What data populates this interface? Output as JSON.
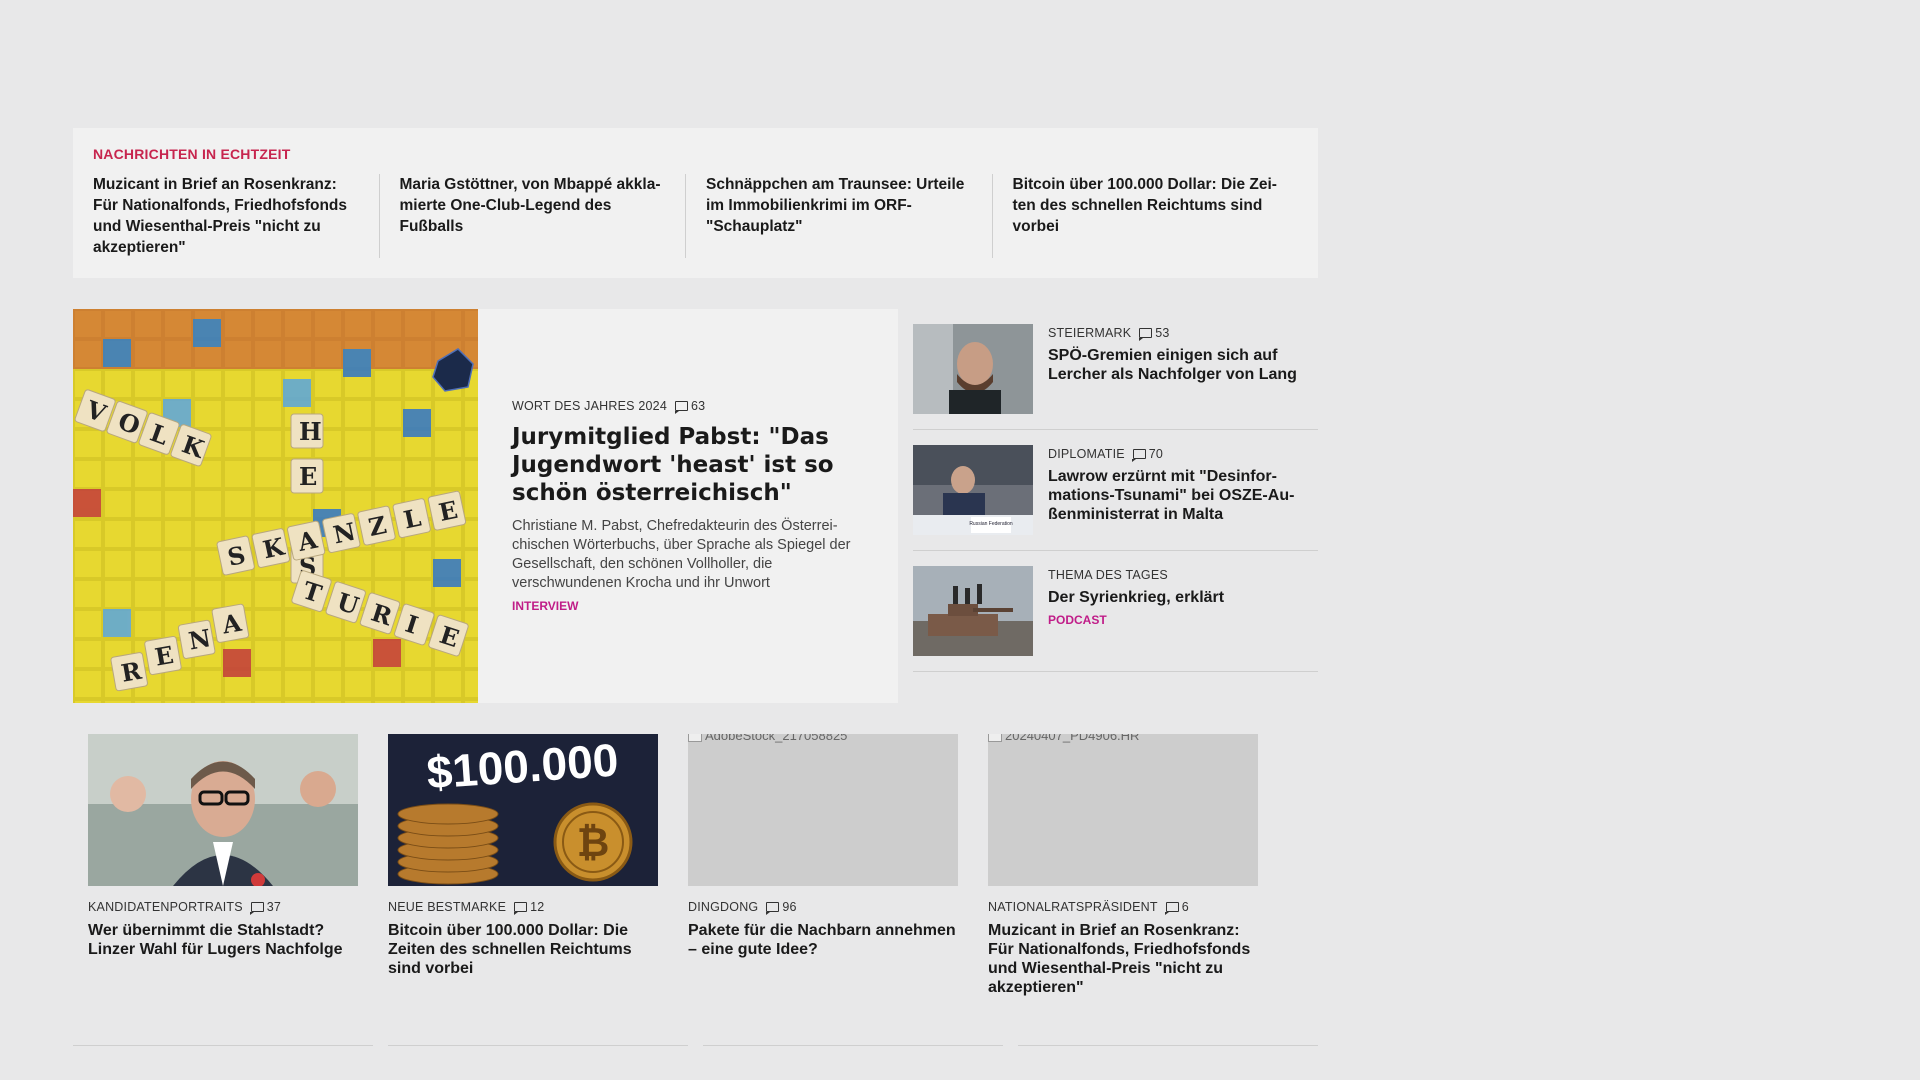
{
  "ticker": {
    "title": "NACHRICHTEN IN ECHTZEIT",
    "items": [
      "Muzicant in Brief an Rosenkranz: Für Nationalfonds, Friedhofsfonds und Wiesenthal-Preis \"nicht zu akzeptieren\"",
      "Maria Gstöttner, von Mbappé akkla­mierte One-Club-Legend des Fußballs",
      "Schnäppchen am Traunsee: Urteile im Immobilienkrimi im ORF-\"Schauplatz\"",
      "Bitcoin über 100.000 Dollar: Die Zei­ten des schnellen Reichtums sind vorbei"
    ]
  },
  "hero": {
    "kicker": "WORT DES JAHRES 2024",
    "comments": "63",
    "title": "Jurymitglied Pabst: \"Das Jugendwort 'heast' ist so schön österreichisch\"",
    "teaser": "Christiane M. Pabst, Chefredakteurin des Österrei­chischen Wörterbuchs, über Sprache als Spiegel der Gesellschaft, den schönen Vollholler, die verschwundenen Krocha und ihr Unwort",
    "tag": "INTERVIEW",
    "scrabble_words": [
      "HEAST",
      "VOLKSKANZLER",
      "RENATURIERUNG"
    ]
  },
  "side": [
    {
      "kicker": "STEIERMARK",
      "comments": "53",
      "title": "SPÖ-Gremien einigen sich auf Lercher als Nachfolger von Lang",
      "tag": ""
    },
    {
      "kicker": "DIPLOMATIE",
      "comments": "70",
      "title": "Lawrow erzürnt mit \"Desinfor­mations-Tsunami\" bei OSZE-Au­ßenministerrat in Malta",
      "tag": "",
      "photo_label": "Russian Federation"
    },
    {
      "kicker": "THEMA DES TAGES",
      "comments": "",
      "title": "Der Syrienkrieg, erklärt",
      "tag": "PODCAST"
    }
  ],
  "cards": [
    {
      "kicker": "KANDIDATENPORTRAITS",
      "comments": "37",
      "title": "Wer übernimmt die Stahlstadt? Linzer Wahl für Lugers Nachfolge",
      "alt": ""
    },
    {
      "kicker": "NEUE BESTMARKE",
      "comments": "12",
      "title": "Bitcoin über 100.000 Dollar: Die Zeiten des schnellen Reichtums sind vorbei",
      "alt": "",
      "img_text": "$100.000",
      "coin_symbol": "₿"
    },
    {
      "kicker": "DINGDONG",
      "comments": "96",
      "title": "Pakete für die Nachbarn annehmen – eine gute Idee?",
      "alt": "AdobeStock_217058825"
    },
    {
      "kicker": "NATIONALRATSPRÄSIDENT",
      "comments": "6",
      "title": "Muzicant in Brief an Rosenkranz: Für Nationalfonds, Friedhofsfonds und Wiesenthal-Preis \"nicht zu akzeptieren\"",
      "alt": "20240407_PD4906.HR"
    }
  ],
  "colors": {
    "accent_red": "#c7254e",
    "tag_magenta": "#c01c88",
    "background": "#e8e8e9",
    "panel": "#f1f1f1"
  }
}
